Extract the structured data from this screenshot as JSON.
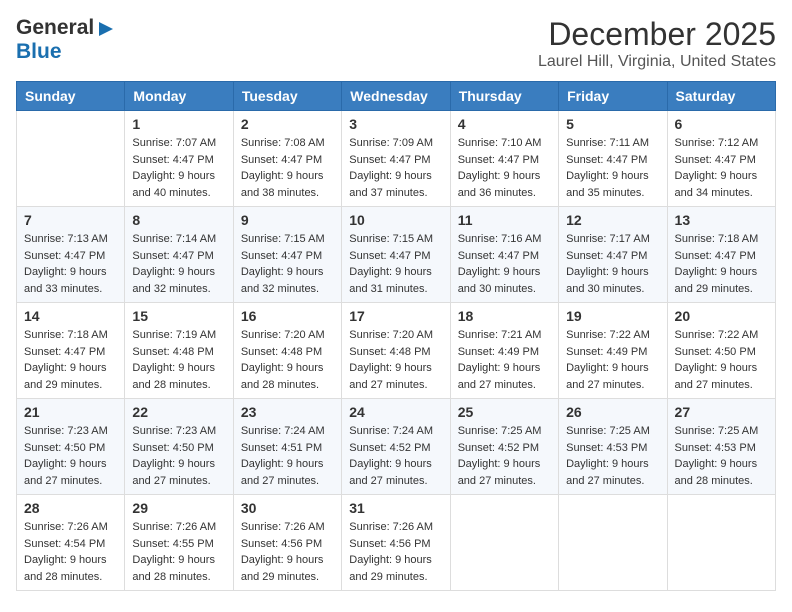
{
  "header": {
    "logo_general": "General",
    "logo_blue": "Blue",
    "month": "December 2025",
    "location": "Laurel Hill, Virginia, United States"
  },
  "days_of_week": [
    "Sunday",
    "Monday",
    "Tuesday",
    "Wednesday",
    "Thursday",
    "Friday",
    "Saturday"
  ],
  "weeks": [
    [
      {
        "day": "",
        "sunrise": "",
        "sunset": "",
        "daylight": ""
      },
      {
        "day": "1",
        "sunrise": "7:07 AM",
        "sunset": "4:47 PM",
        "daylight": "9 hours and 40 minutes."
      },
      {
        "day": "2",
        "sunrise": "7:08 AM",
        "sunset": "4:47 PM",
        "daylight": "9 hours and 38 minutes."
      },
      {
        "day": "3",
        "sunrise": "7:09 AM",
        "sunset": "4:47 PM",
        "daylight": "9 hours and 37 minutes."
      },
      {
        "day": "4",
        "sunrise": "7:10 AM",
        "sunset": "4:47 PM",
        "daylight": "9 hours and 36 minutes."
      },
      {
        "day": "5",
        "sunrise": "7:11 AM",
        "sunset": "4:47 PM",
        "daylight": "9 hours and 35 minutes."
      },
      {
        "day": "6",
        "sunrise": "7:12 AM",
        "sunset": "4:47 PM",
        "daylight": "9 hours and 34 minutes."
      }
    ],
    [
      {
        "day": "7",
        "sunrise": "7:13 AM",
        "sunset": "4:47 PM",
        "daylight": "9 hours and 33 minutes."
      },
      {
        "day": "8",
        "sunrise": "7:14 AM",
        "sunset": "4:47 PM",
        "daylight": "9 hours and 32 minutes."
      },
      {
        "day": "9",
        "sunrise": "7:15 AM",
        "sunset": "4:47 PM",
        "daylight": "9 hours and 32 minutes."
      },
      {
        "day": "10",
        "sunrise": "7:15 AM",
        "sunset": "4:47 PM",
        "daylight": "9 hours and 31 minutes."
      },
      {
        "day": "11",
        "sunrise": "7:16 AM",
        "sunset": "4:47 PM",
        "daylight": "9 hours and 30 minutes."
      },
      {
        "day": "12",
        "sunrise": "7:17 AM",
        "sunset": "4:47 PM",
        "daylight": "9 hours and 30 minutes."
      },
      {
        "day": "13",
        "sunrise": "7:18 AM",
        "sunset": "4:47 PM",
        "daylight": "9 hours and 29 minutes."
      }
    ],
    [
      {
        "day": "14",
        "sunrise": "7:18 AM",
        "sunset": "4:47 PM",
        "daylight": "9 hours and 29 minutes."
      },
      {
        "day": "15",
        "sunrise": "7:19 AM",
        "sunset": "4:48 PM",
        "daylight": "9 hours and 28 minutes."
      },
      {
        "day": "16",
        "sunrise": "7:20 AM",
        "sunset": "4:48 PM",
        "daylight": "9 hours and 28 minutes."
      },
      {
        "day": "17",
        "sunrise": "7:20 AM",
        "sunset": "4:48 PM",
        "daylight": "9 hours and 27 minutes."
      },
      {
        "day": "18",
        "sunrise": "7:21 AM",
        "sunset": "4:49 PM",
        "daylight": "9 hours and 27 minutes."
      },
      {
        "day": "19",
        "sunrise": "7:22 AM",
        "sunset": "4:49 PM",
        "daylight": "9 hours and 27 minutes."
      },
      {
        "day": "20",
        "sunrise": "7:22 AM",
        "sunset": "4:50 PM",
        "daylight": "9 hours and 27 minutes."
      }
    ],
    [
      {
        "day": "21",
        "sunrise": "7:23 AM",
        "sunset": "4:50 PM",
        "daylight": "9 hours and 27 minutes."
      },
      {
        "day": "22",
        "sunrise": "7:23 AM",
        "sunset": "4:50 PM",
        "daylight": "9 hours and 27 minutes."
      },
      {
        "day": "23",
        "sunrise": "7:24 AM",
        "sunset": "4:51 PM",
        "daylight": "9 hours and 27 minutes."
      },
      {
        "day": "24",
        "sunrise": "7:24 AM",
        "sunset": "4:52 PM",
        "daylight": "9 hours and 27 minutes."
      },
      {
        "day": "25",
        "sunrise": "7:25 AM",
        "sunset": "4:52 PM",
        "daylight": "9 hours and 27 minutes."
      },
      {
        "day": "26",
        "sunrise": "7:25 AM",
        "sunset": "4:53 PM",
        "daylight": "9 hours and 27 minutes."
      },
      {
        "day": "27",
        "sunrise": "7:25 AM",
        "sunset": "4:53 PM",
        "daylight": "9 hours and 28 minutes."
      }
    ],
    [
      {
        "day": "28",
        "sunrise": "7:26 AM",
        "sunset": "4:54 PM",
        "daylight": "9 hours and 28 minutes."
      },
      {
        "day": "29",
        "sunrise": "7:26 AM",
        "sunset": "4:55 PM",
        "daylight": "9 hours and 28 minutes."
      },
      {
        "day": "30",
        "sunrise": "7:26 AM",
        "sunset": "4:56 PM",
        "daylight": "9 hours and 29 minutes."
      },
      {
        "day": "31",
        "sunrise": "7:26 AM",
        "sunset": "4:56 PM",
        "daylight": "9 hours and 29 minutes."
      },
      {
        "day": "",
        "sunrise": "",
        "sunset": "",
        "daylight": ""
      },
      {
        "day": "",
        "sunrise": "",
        "sunset": "",
        "daylight": ""
      },
      {
        "day": "",
        "sunrise": "",
        "sunset": "",
        "daylight": ""
      }
    ]
  ]
}
